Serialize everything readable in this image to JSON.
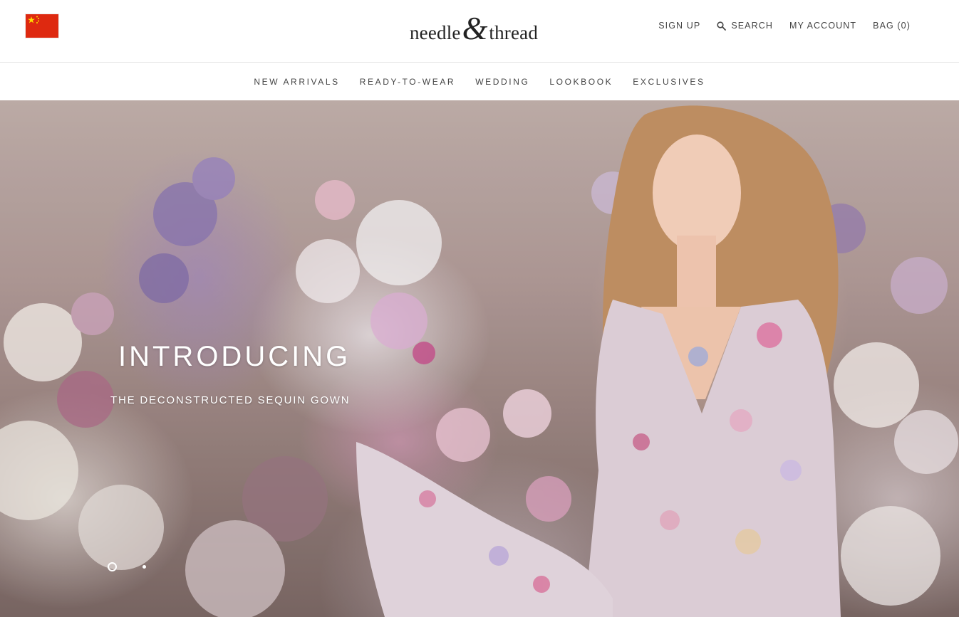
{
  "header": {
    "country_flag": "china-flag-icon",
    "logo": {
      "left": "needle",
      "amp": "&",
      "right": "thread"
    },
    "utility_links": {
      "sign_up": "SIGN UP",
      "search": "SEARCH",
      "account": "MY ACCOUNT",
      "bag": "BAG (0)"
    }
  },
  "main_nav": {
    "items": [
      "NEW ARRIVALS",
      "READY-TO-WEAR",
      "WEDDING",
      "LOOKBOOK",
      "EXCLUSIVES"
    ]
  },
  "hero": {
    "title": "INTRODUCING",
    "subtitle": "THE DECONSTRUCTED SEQUIN GOWN",
    "slide_count": 2,
    "active_slide": 1
  },
  "colors": {
    "flag_red": "#de2910",
    "flag_star": "#ffde00",
    "text": "#444444",
    "hero_text": "#ffffff"
  }
}
